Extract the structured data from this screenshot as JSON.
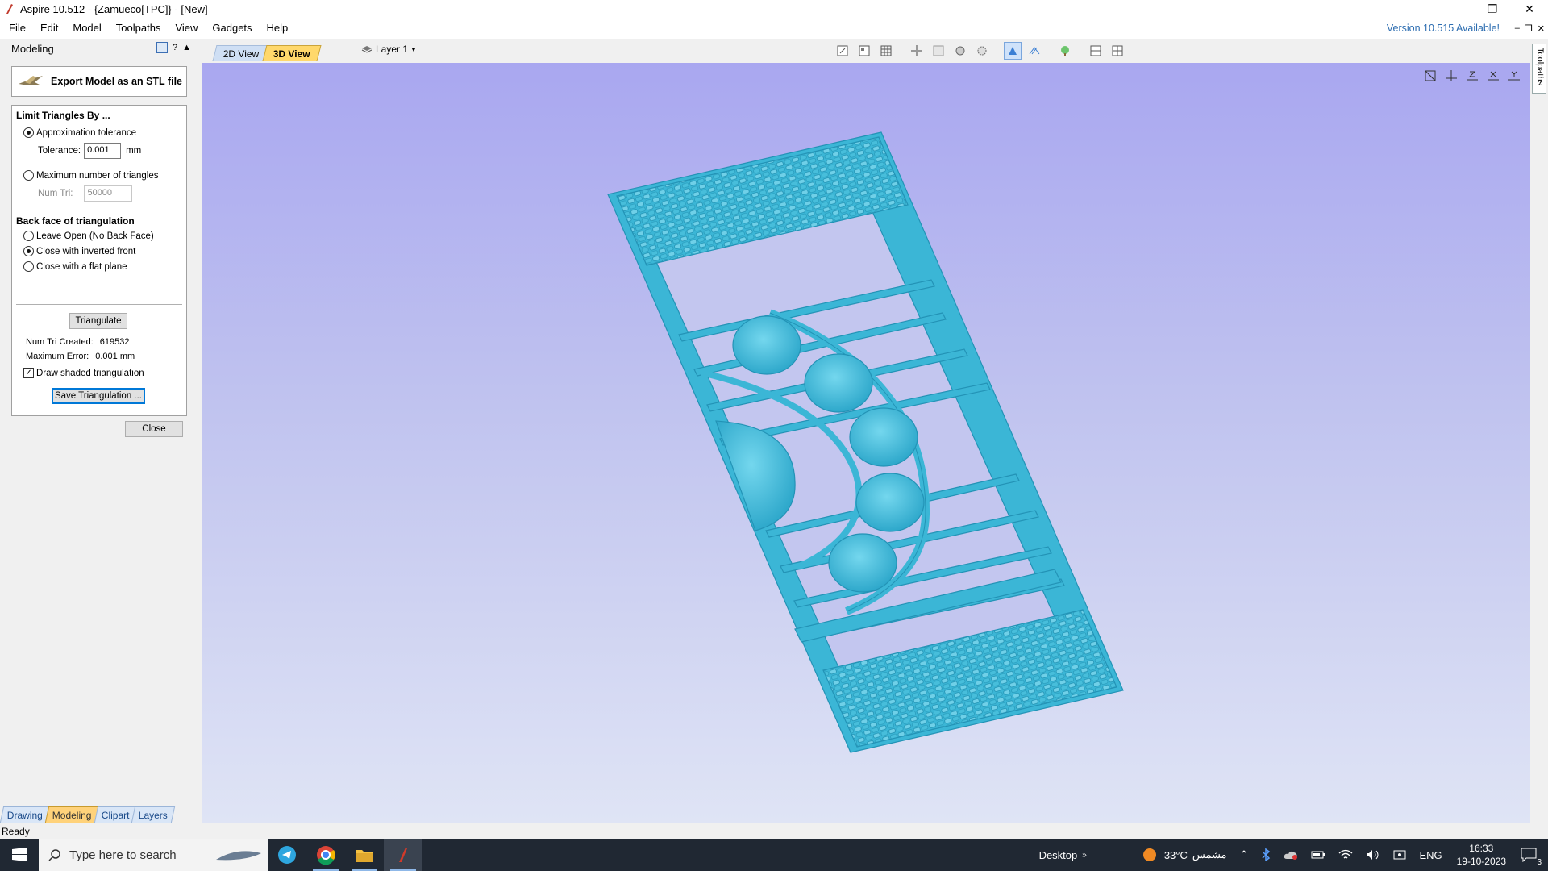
{
  "window": {
    "title": "Aspire 10.512 - {Zamueco[TPC]} - [New]"
  },
  "menu": {
    "items": [
      "File",
      "Edit",
      "Model",
      "Toolpaths",
      "View",
      "Gadgets",
      "Help"
    ],
    "version_notice": "Version 10.515 Available!"
  },
  "left_panel": {
    "header": "Modeling",
    "export_title": "Export Model as an STL file",
    "limit_title": "Limit Triangles By ...",
    "opt_approx": "Approximation tolerance",
    "tolerance_label": "Tolerance:",
    "tolerance_value": "0.001",
    "tolerance_unit": "mm",
    "opt_max_tri": "Maximum number of triangles",
    "num_tri_label": "Num Tri:",
    "num_tri_value": "50000",
    "backface_title": "Back face of triangulation",
    "opt_leave_open": "Leave Open (No Back Face)",
    "opt_inverted": "Close with inverted front",
    "opt_flat": "Close with a flat plane",
    "triangulate_btn": "Triangulate",
    "num_tri_created_label": "Num Tri Created:",
    "num_tri_created_value": "619532",
    "max_error_label": "Maximum Error:",
    "max_error_value": "0.001 mm",
    "draw_shaded": "Draw shaded triangulation",
    "save_btn": "Save Triangulation ...",
    "close_btn": "Close",
    "tabs": [
      "Drawing",
      "Modeling",
      "Clipart",
      "Layers"
    ],
    "active_tab": "Modeling"
  },
  "view_tabs": {
    "tab_2d": "2D View",
    "tab_3d": "3D View",
    "layer": "Layer 1"
  },
  "right_tab": "Toolpaths",
  "status": "Ready",
  "taskbar": {
    "search_placeholder": "Type here to search",
    "desktop": "Desktop",
    "weather": "33°C",
    "weather_desc": "مشمس",
    "lang": "ENG",
    "time": "16:33",
    "date": "19-10-2023",
    "notif_count": "3"
  },
  "colors": {
    "model": "#3bb6d6",
    "accent": "#2b6cb0"
  }
}
